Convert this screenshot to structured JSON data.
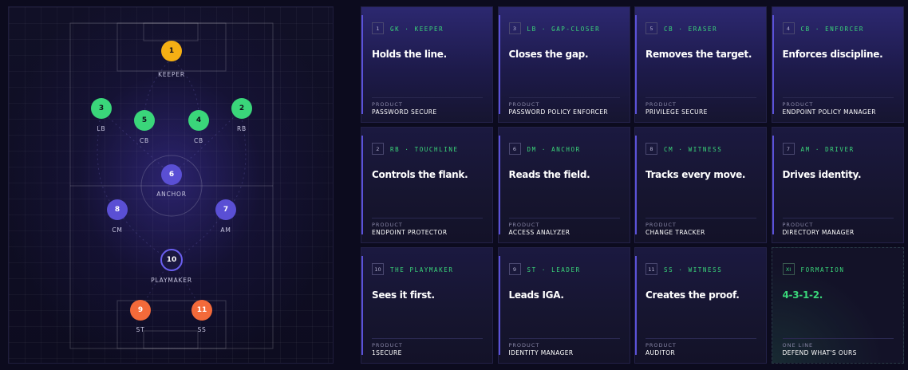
{
  "pitch": {
    "players": [
      {
        "num": "1",
        "label": "KEEPER",
        "type": "keeper"
      },
      {
        "num": "3",
        "label": "LB",
        "type": "def"
      },
      {
        "num": "5",
        "label": "CB",
        "type": "def"
      },
      {
        "num": "4",
        "label": "CB",
        "type": "def"
      },
      {
        "num": "2",
        "label": "RB",
        "type": "def"
      },
      {
        "num": "6",
        "label": "ANCHOR",
        "type": "mid"
      },
      {
        "num": "8",
        "label": "CM",
        "type": "mid"
      },
      {
        "num": "7",
        "label": "AM",
        "type": "mid"
      },
      {
        "num": "10",
        "label": "PLAYMAKER",
        "type": "play"
      },
      {
        "num": "9",
        "label": "ST",
        "type": "att"
      },
      {
        "num": "11",
        "label": "SS",
        "type": "att"
      }
    ]
  },
  "cards": [
    {
      "num": "1",
      "role": "GK · KEEPER",
      "headline": "Holds the line.",
      "product_label": "PRODUCT",
      "product": "PASSWORD SECURE"
    },
    {
      "num": "3",
      "role": "LB · GAP-CLOSER",
      "headline": "Closes the gap.",
      "product_label": "PRODUCT",
      "product": "PASSWORD POLICY ENFORCER"
    },
    {
      "num": "5",
      "role": "CB · ERASER",
      "headline": "Removes the target.",
      "product_label": "PRODUCT",
      "product": "PRIVILEGE SECURE"
    },
    {
      "num": "4",
      "role": "CB · ENFORCER",
      "headline": "Enforces discipline.",
      "product_label": "PRODUCT",
      "product": "ENDPOINT POLICY MANAGER"
    },
    {
      "num": "2",
      "role": "RB · TOUCHLINE",
      "headline": "Controls the flank.",
      "product_label": "PRODUCT",
      "product": "ENDPOINT PROTECTOR"
    },
    {
      "num": "6",
      "role": "DM · ANCHOR",
      "headline": "Reads the field.",
      "product_label": "PRODUCT",
      "product": "ACCESS ANALYZER"
    },
    {
      "num": "8",
      "role": "CM · WITNESS",
      "headline": "Tracks every move.",
      "product_label": "PRODUCT",
      "product": "CHANGE TRACKER"
    },
    {
      "num": "7",
      "role": "AM · DRIVER",
      "headline": "Drives identity.",
      "product_label": "PRODUCT",
      "product": "DIRECTORY MANAGER"
    },
    {
      "num": "10",
      "role": "THE PLAYMAKER",
      "headline": "Sees it first.",
      "product_label": "PRODUCT",
      "product": "1SECURE"
    },
    {
      "num": "9",
      "role": "ST · LEADER",
      "headline": "Leads IGA.",
      "product_label": "PRODUCT",
      "product": "IDENTITY MANAGER"
    },
    {
      "num": "11",
      "role": "SS · WITNESS",
      "headline": "Creates the proof.",
      "product_label": "PRODUCT",
      "product": "AUDITOR"
    },
    {
      "num": "XI",
      "role": "FORMATION",
      "headline": "4-3-1-2.",
      "product_label": "ONE LINE",
      "product": "DEFEND WHAT'S OURS"
    }
  ],
  "colors": {
    "keeper": "#f5b014",
    "defender": "#3ad67a",
    "midfielder": "#5a4fd4",
    "attacker": "#f36a3a",
    "accent": "#5b52d9"
  }
}
